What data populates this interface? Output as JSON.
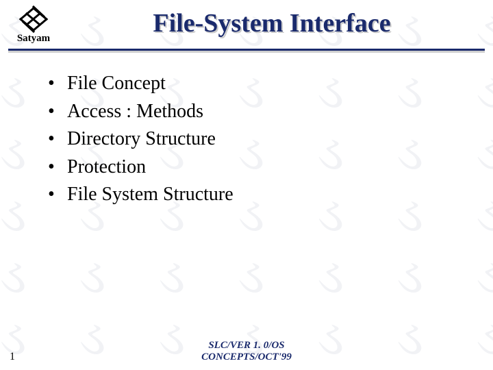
{
  "logo": {
    "text": "Satyam",
    "icon_name": "satyam-logo-icon"
  },
  "title": "File-System Interface",
  "bullets": [
    "File Concept",
    "Access : Methods",
    "Directory Structure",
    "Protection",
    "File System Structure"
  ],
  "footer": {
    "page_number": "1",
    "line1": "SLC/VER 1. 0/OS",
    "line2": "CONCEPTS/OCT'99"
  },
  "colors": {
    "heading": "#1a2a6c",
    "rule": "#1a2a6c"
  }
}
